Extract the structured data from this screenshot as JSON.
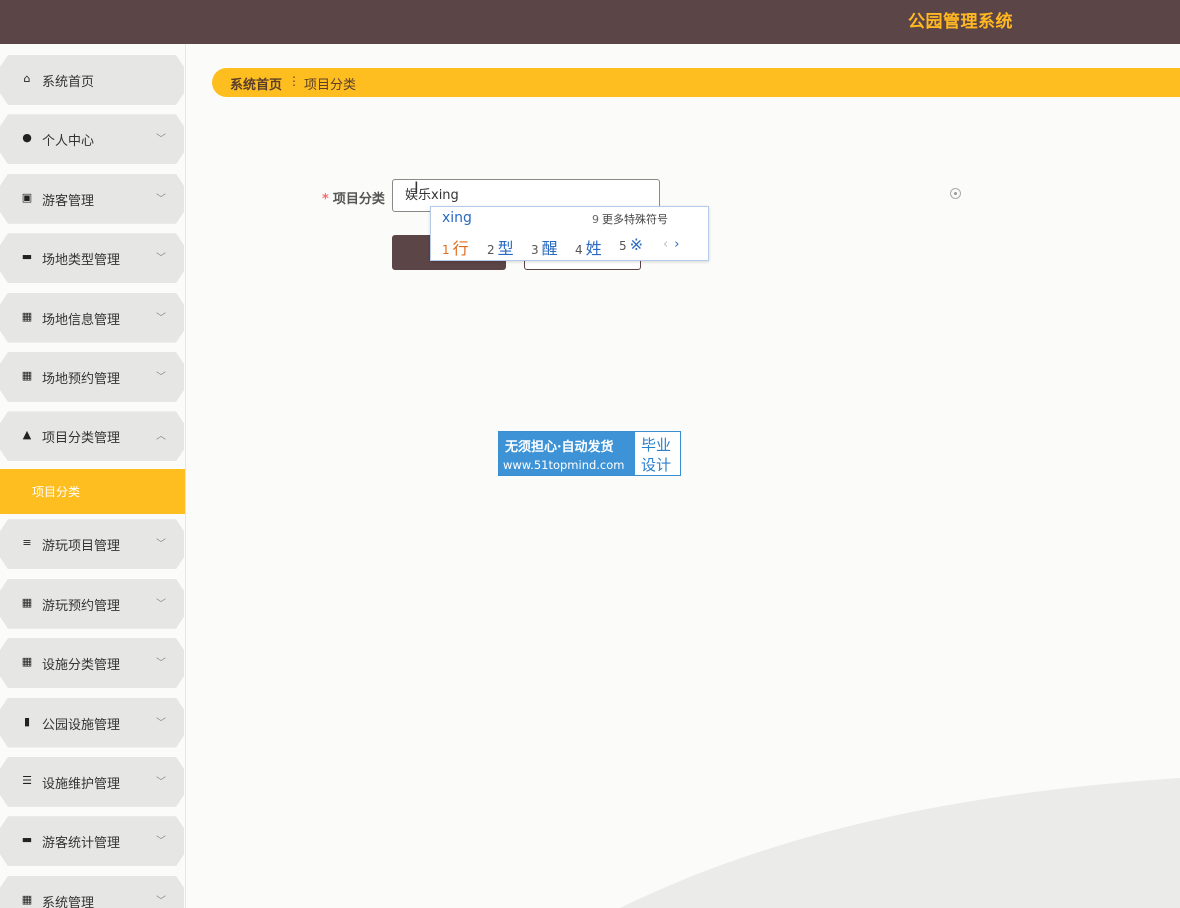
{
  "app": {
    "title": "公园管理系统"
  },
  "sidebar": {
    "items": [
      {
        "label": "系统首页",
        "icon": "home-icon",
        "glyph": "⌂",
        "has_arrow": false
      },
      {
        "label": "个人中心",
        "icon": "user-icon",
        "glyph": "●",
        "has_arrow": true
      },
      {
        "label": "游客管理",
        "icon": "clipboard-icon",
        "glyph": "▣",
        "has_arrow": true
      },
      {
        "label": "场地类型管理",
        "icon": "monitor-icon",
        "glyph": "▬",
        "has_arrow": true
      },
      {
        "label": "场地信息管理",
        "icon": "grid-icon",
        "glyph": "▦",
        "has_arrow": true
      },
      {
        "label": "场地预约管理",
        "icon": "grid-icon",
        "glyph": "▦",
        "has_arrow": true
      },
      {
        "label": "项目分类管理",
        "icon": "person-icon",
        "glyph": "▲",
        "has_arrow": true,
        "expanded": true
      },
      {
        "label": "游玩项目管理",
        "icon": "list-icon",
        "glyph": "≡",
        "has_arrow": true
      },
      {
        "label": "游玩预约管理",
        "icon": "grid-icon",
        "glyph": "▦",
        "has_arrow": true
      },
      {
        "label": "设施分类管理",
        "icon": "grid-icon",
        "glyph": "▦",
        "has_arrow": true
      },
      {
        "label": "公园设施管理",
        "icon": "bar-chart-icon",
        "glyph": "▮",
        "has_arrow": true
      },
      {
        "label": "设施维护管理",
        "icon": "sliders-icon",
        "glyph": "☰",
        "has_arrow": true
      },
      {
        "label": "游客统计管理",
        "icon": "briefcase-icon",
        "glyph": "▬",
        "has_arrow": true
      },
      {
        "label": "系统管理",
        "icon": "grid-icon",
        "glyph": "▦",
        "has_arrow": true
      }
    ],
    "active_submenu": "项目分类"
  },
  "breadcrumb": {
    "home": "系统首页",
    "separator": "⋮",
    "current": "项目分类"
  },
  "form": {
    "field_label": "项目分类",
    "required_mark": "*",
    "field_value": "娱乐xing"
  },
  "ime": {
    "pinyin": "xing",
    "more_num": "9",
    "more_label": "更多特殊符号",
    "candidates": [
      {
        "n": "1",
        "text": "行"
      },
      {
        "n": "2",
        "text": "型"
      },
      {
        "n": "3",
        "text": "醒"
      },
      {
        "n": "4",
        "text": "姓"
      },
      {
        "n": "5",
        "text": "※"
      }
    ],
    "prev": "‹",
    "next": "›"
  },
  "watermark": {
    "line1": "无须担心·自动发货",
    "line2": "www.51topmind.com",
    "right1": "毕业",
    "right2": "设计"
  }
}
